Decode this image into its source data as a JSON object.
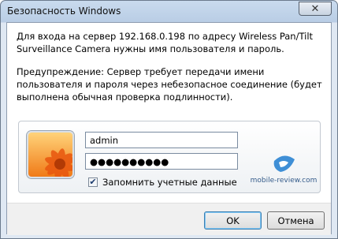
{
  "window": {
    "title": "Безопасность Windows",
    "close_glyph": "✕"
  },
  "message": {
    "line1": "Для входа на сервер 192.168.0.198 по адресу Wireless Pan/Tilt Surveillance Camera нужны имя пользователя и пароль.",
    "warning": "Предупреждение: Сервер требует передачи имени пользователя и пароля через небезопасное соединение (будет выполнена обычная проверка подлинности)."
  },
  "credentials": {
    "username": "admin",
    "password": "●●●●●●●●●●",
    "remember_label": "Запомнить учетные данные",
    "remember_checked": true,
    "check_glyph": "✔"
  },
  "watermark": {
    "text": "mobile-review.com"
  },
  "buttons": {
    "ok": "OK",
    "cancel": "Отмена"
  },
  "colors": {
    "accent": "#1c6ec9",
    "logo": "#3f8fd6"
  }
}
